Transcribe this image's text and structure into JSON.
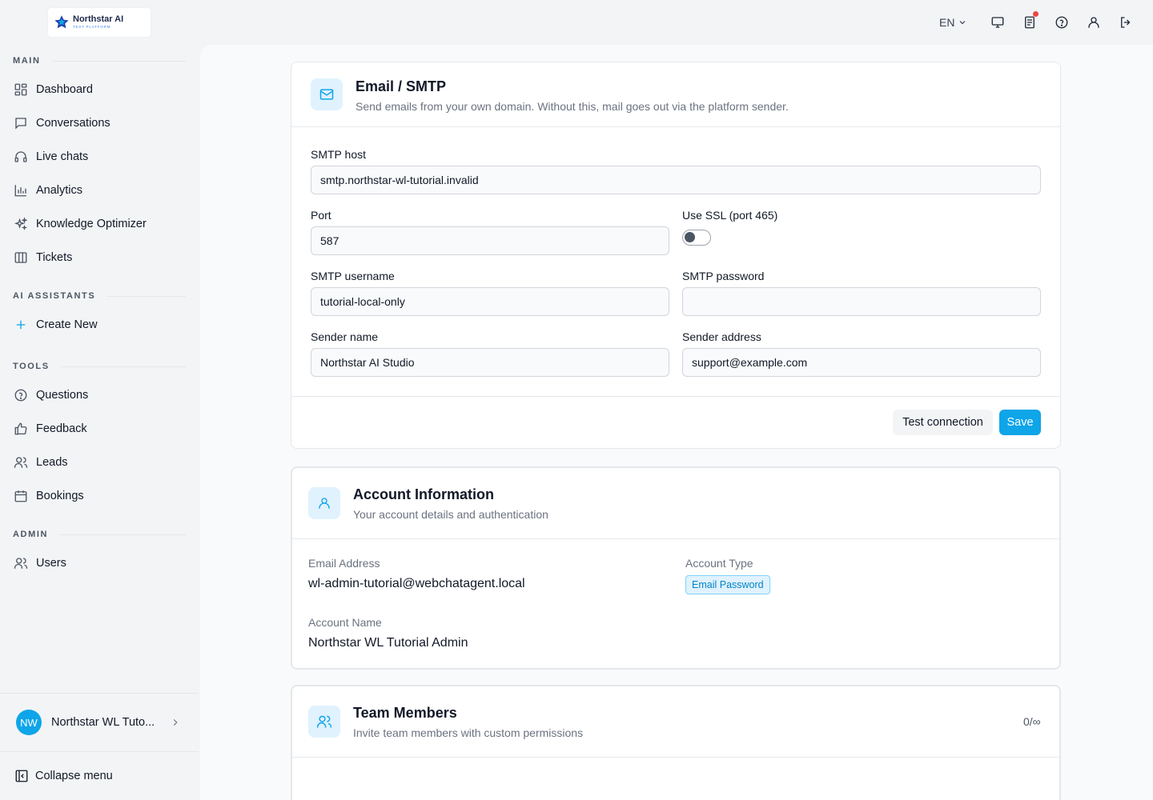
{
  "brand": {
    "name": "Northstar AI",
    "tagline": "TEST PLATFORM"
  },
  "topbar": {
    "language": "EN",
    "icons": [
      "monitor-icon",
      "changelog-icon",
      "help-icon",
      "user-icon",
      "logout-icon"
    ]
  },
  "sidebar": {
    "sections": {
      "main": "MAIN",
      "ai_assistants": "AI ASSISTANTS",
      "tools": "TOOLS",
      "admin": "ADMIN"
    },
    "main_items": [
      {
        "label": "Dashboard",
        "icon": "dashboard-icon"
      },
      {
        "label": "Conversations",
        "icon": "chat-icon"
      },
      {
        "label": "Live chats",
        "icon": "headset-icon"
      },
      {
        "label": "Analytics",
        "icon": "bar-chart-icon"
      },
      {
        "label": "Knowledge Optimizer",
        "icon": "sparkles-icon"
      },
      {
        "label": "Tickets",
        "icon": "columns-icon"
      }
    ],
    "assistant_items": [
      {
        "label": "Create New",
        "icon": "plus-icon"
      }
    ],
    "tool_items": [
      {
        "label": "Questions",
        "icon": "question-icon"
      },
      {
        "label": "Feedback",
        "icon": "thumbs-up-icon"
      },
      {
        "label": "Leads",
        "icon": "users-icon"
      },
      {
        "label": "Bookings",
        "icon": "calendar-icon"
      }
    ],
    "admin_items": [
      {
        "label": "Users",
        "icon": "users-icon"
      }
    ],
    "user": {
      "initials": "NW",
      "name": "Northstar WL Tuto..."
    },
    "collapse_label": "Collapse menu"
  },
  "smtp": {
    "title": "Email / SMTP",
    "subtitle": "Send emails from your own domain. Without this, mail goes out via the platform sender.",
    "host_label": "SMTP host",
    "host_value": "smtp.northstar-wl-tutorial.invalid",
    "port_label": "Port",
    "port_value": "587",
    "ssl_label": "Use SSL (port 465)",
    "ssl_enabled": false,
    "username_label": "SMTP username",
    "username_value": "tutorial-local-only",
    "password_label": "SMTP password",
    "password_value": "",
    "sender_name_label": "Sender name",
    "sender_name_value": "Northstar AI Studio",
    "sender_address_label": "Sender address",
    "sender_address_value": "support@example.com",
    "test_button": "Test connection",
    "save_button": "Save"
  },
  "account": {
    "title": "Account Information",
    "subtitle": "Your account details and authentication",
    "email_label": "Email Address",
    "email_value": "wl-admin-tutorial@webchatagent.local",
    "type_label": "Account Type",
    "type_value": "Email Password",
    "name_label": "Account Name",
    "name_value": "Northstar WL Tutorial Admin"
  },
  "team": {
    "title": "Team Members",
    "subtitle": "Invite team members with custom permissions",
    "count": "0/∞"
  },
  "colors": {
    "accent": "#0ea5e9",
    "accent_soft": "#e0f2fe",
    "notification": "#ef4444"
  }
}
